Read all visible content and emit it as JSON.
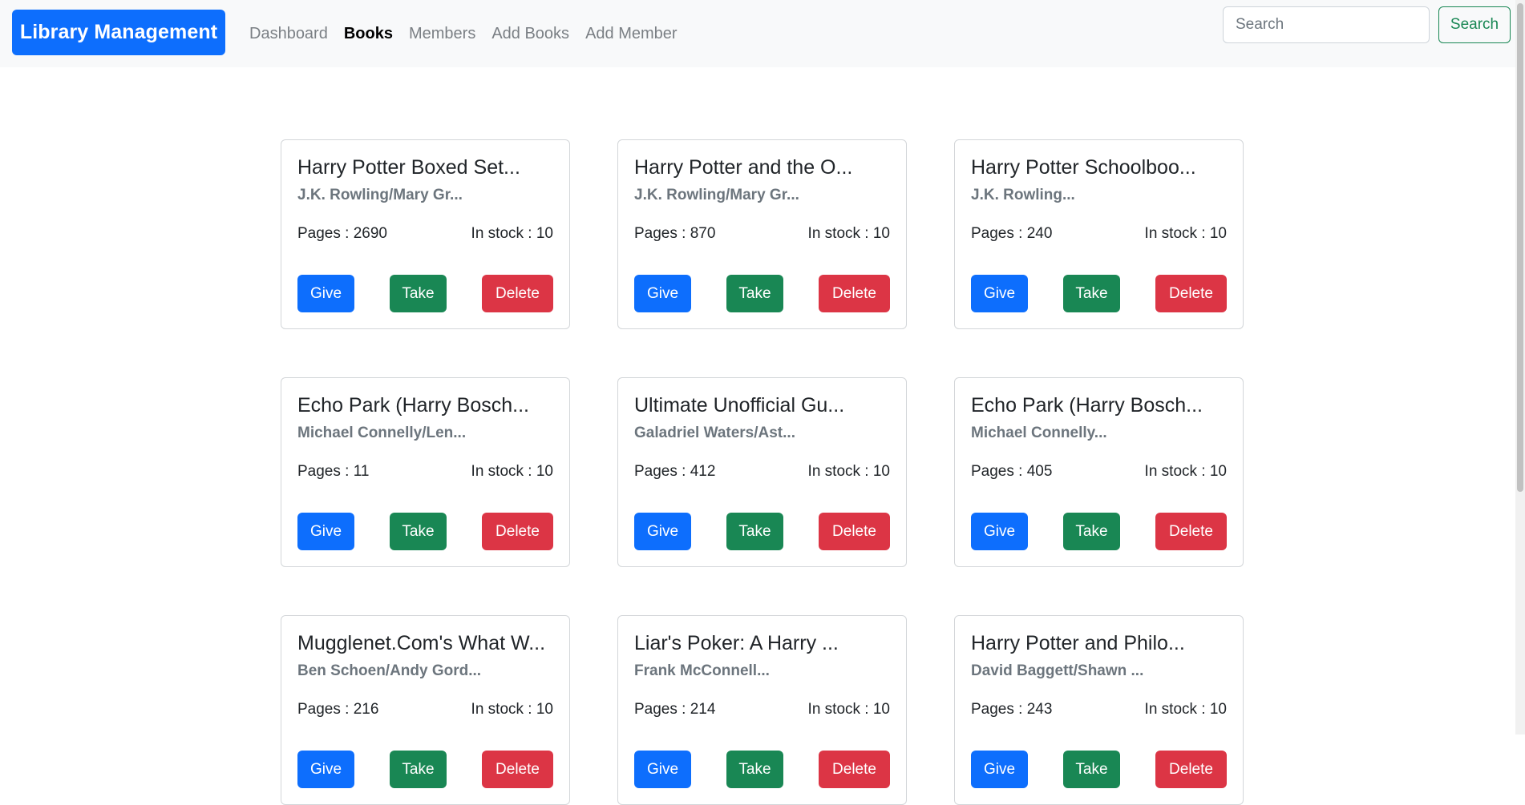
{
  "navbar": {
    "brand": "Library Management",
    "links": [
      {
        "label": "Dashboard",
        "active": false
      },
      {
        "label": "Books",
        "active": true
      },
      {
        "label": "Members",
        "active": false
      },
      {
        "label": "Add Books",
        "active": false
      },
      {
        "label": "Add Member",
        "active": false
      }
    ],
    "search_placeholder": "Search",
    "search_button": "Search"
  },
  "labels": {
    "pages_prefix": "Pages : ",
    "stock_prefix": "In stock : ",
    "give": "Give",
    "take": "Take",
    "delete": "Delete"
  },
  "books": [
    {
      "title": "Harry Potter Boxed Set...",
      "author": "J.K. Rowling/Mary Gr...",
      "pages": "2690",
      "stock": "10"
    },
    {
      "title": "Harry Potter and the O...",
      "author": "J.K. Rowling/Mary Gr...",
      "pages": "870",
      "stock": "10"
    },
    {
      "title": "Harry Potter Schoolboo...",
      "author": "J.K. Rowling...",
      "pages": "240",
      "stock": "10"
    },
    {
      "title": "Echo Park (Harry Bosch...",
      "author": "Michael Connelly/Len...",
      "pages": "11",
      "stock": "10"
    },
    {
      "title": "Ultimate Unofficial Gu...",
      "author": "Galadriel Waters/Ast...",
      "pages": "412",
      "stock": "10"
    },
    {
      "title": "Echo Park (Harry Bosch...",
      "author": "Michael Connelly...",
      "pages": "405",
      "stock": "10"
    },
    {
      "title": "Mugglenet.Com's What W...",
      "author": "Ben Schoen/Andy Gord...",
      "pages": "216",
      "stock": "10"
    },
    {
      "title": "Liar's Poker: A Harry ...",
      "author": "Frank McConnell...",
      "pages": "214",
      "stock": "10"
    },
    {
      "title": "Harry Potter and Philo...",
      "author": "David Baggett/Shawn ...",
      "pages": "243",
      "stock": "10"
    }
  ],
  "colors": {
    "primary": "#0d6efd",
    "success": "#198754",
    "danger": "#dc3545",
    "navbar_bg": "#f8f9fa"
  }
}
